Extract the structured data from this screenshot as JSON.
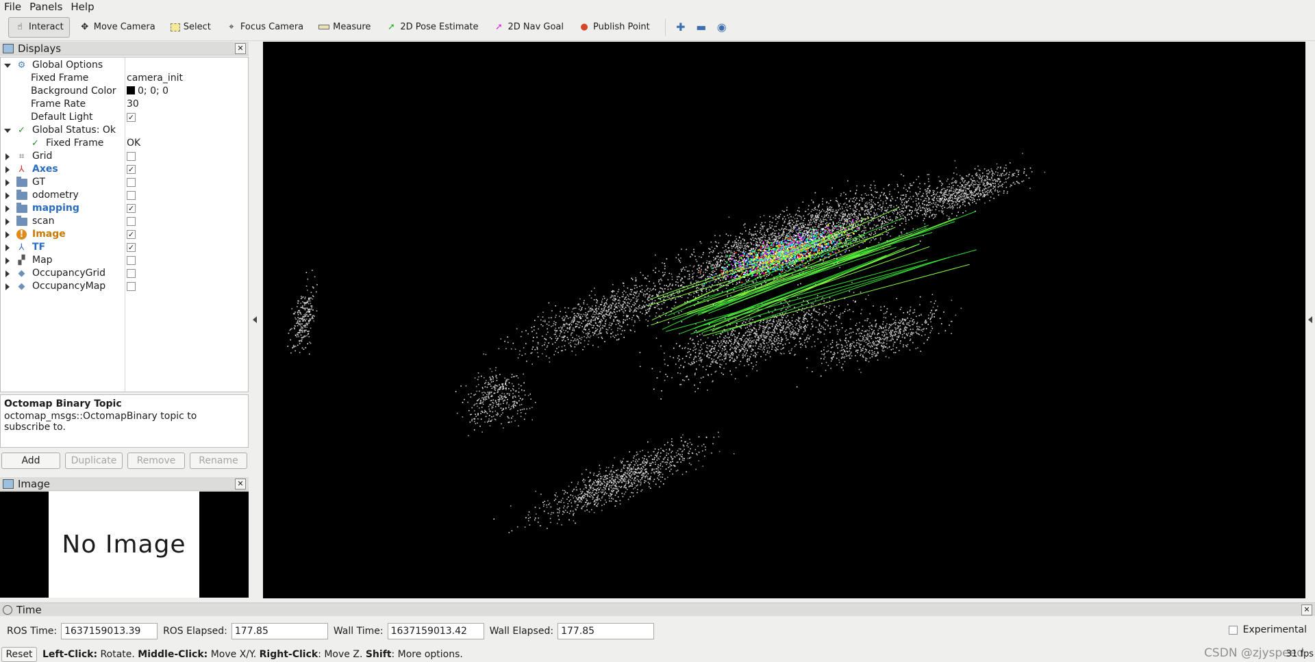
{
  "menubar": {
    "items": [
      "File",
      "Panels",
      "Help"
    ]
  },
  "toolbar": {
    "tools": [
      {
        "label": "Interact",
        "icon": "hand-icon",
        "active": true
      },
      {
        "label": "Move Camera",
        "icon": "move-camera-icon"
      },
      {
        "label": "Select",
        "icon": "select-icon"
      },
      {
        "label": "Focus Camera",
        "icon": "focus-camera-icon"
      },
      {
        "label": "Measure",
        "icon": "ruler-icon"
      },
      {
        "label": "2D Pose Estimate",
        "icon": "green-arrow-icon"
      },
      {
        "label": "2D Nav Goal",
        "icon": "magenta-arrow-icon"
      },
      {
        "label": "Publish Point",
        "icon": "pin-icon"
      }
    ],
    "extras": [
      "plus-icon",
      "minus-icon",
      "eye-icon"
    ]
  },
  "displays": {
    "title": "Displays",
    "rows": [
      {
        "label": "Global Options",
        "value": ""
      },
      {
        "label": "Fixed Frame",
        "value": "camera_init"
      },
      {
        "label": "Background Color",
        "value": "0; 0; 0"
      },
      {
        "label": "Frame Rate",
        "value": "30"
      },
      {
        "label": "Default Light",
        "checked": true
      },
      {
        "label": "Global Status: Ok"
      },
      {
        "label": "Fixed Frame",
        "value": "OK"
      },
      {
        "label": "Grid",
        "checked": false
      },
      {
        "label": "Axes",
        "checked": true
      },
      {
        "label": "GT",
        "checked": false
      },
      {
        "label": "odometry",
        "checked": false
      },
      {
        "label": "mapping",
        "checked": true
      },
      {
        "label": "scan",
        "checked": false
      },
      {
        "label": "Image",
        "checked": true
      },
      {
        "label": "TF",
        "checked": true
      },
      {
        "label": "Map",
        "checked": false
      },
      {
        "label": "OccupancyGrid",
        "checked": false
      },
      {
        "label": "OccupancyMap",
        "checked": false
      }
    ],
    "description": {
      "title": "Octomap Binary Topic",
      "text": "octomap_msgs::OctomapBinary topic to subscribe to."
    },
    "buttons": {
      "add": "Add",
      "duplicate": "Duplicate",
      "remove": "Remove",
      "rename": "Rename"
    }
  },
  "image_panel": {
    "title": "Image",
    "placeholder": "No Image"
  },
  "time_panel": {
    "title": "Time",
    "ros_time_label": "ROS Time:",
    "ros_time": "1637159013.39",
    "ros_elapsed_label": "ROS Elapsed:",
    "ros_elapsed": "177.85",
    "wall_time_label": "Wall Time:",
    "wall_time": "1637159013.42",
    "wall_elapsed_label": "Wall Elapsed:",
    "wall_elapsed": "177.85",
    "experimental": "Experimental"
  },
  "statusbar": {
    "reset": "Reset",
    "hints": [
      {
        "key": "Left-Click:",
        "text": " Rotate. "
      },
      {
        "key": "Middle-Click:",
        "text": " Move X/Y. "
      },
      {
        "key": "Right-Click:",
        "text": ": Move Z. "
      },
      {
        "key": "Shift",
        "text": ": More options."
      }
    ],
    "fps": "31 fps",
    "watermark": "CSDN @zjyspeed"
  }
}
